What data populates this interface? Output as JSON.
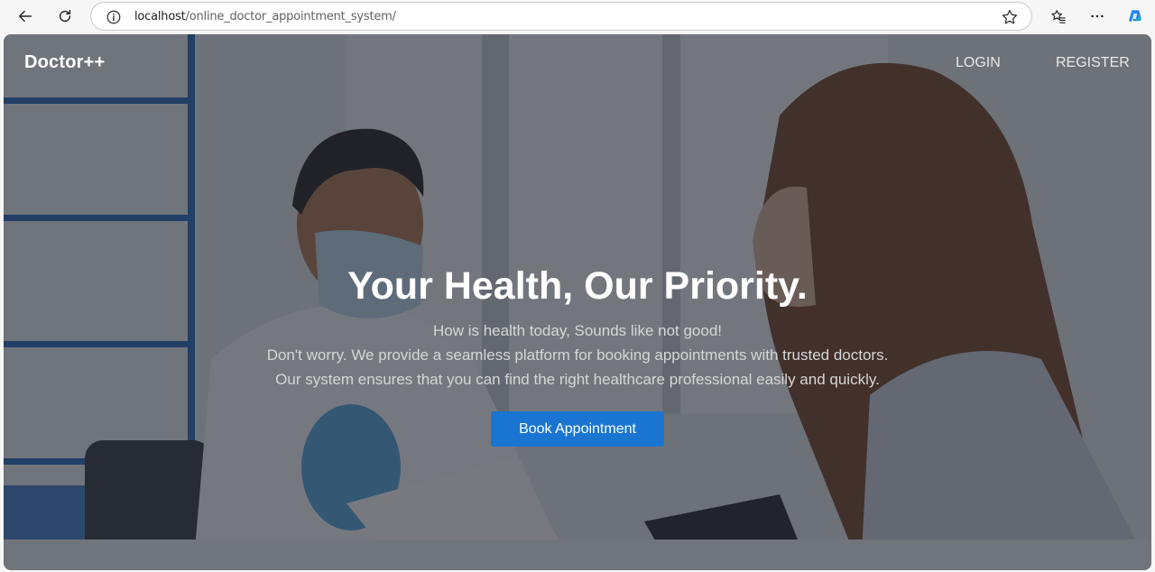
{
  "browser": {
    "url_host": "localhost",
    "url_path": "/online_doctor_appointment_system/"
  },
  "page": {
    "brand": "Doctor++",
    "nav": {
      "login": "LOGIN",
      "register": "REGISTER"
    },
    "hero": {
      "title": "Your Health, Our Priority.",
      "line1": "How is health today, Sounds like not good!",
      "line2": "Don't worry. We provide a seamless platform for booking appointments with trusted doctors.",
      "line3": "Our system ensures that you can find the right healthcare professional easily and quickly.",
      "cta": "Book Appointment"
    }
  }
}
